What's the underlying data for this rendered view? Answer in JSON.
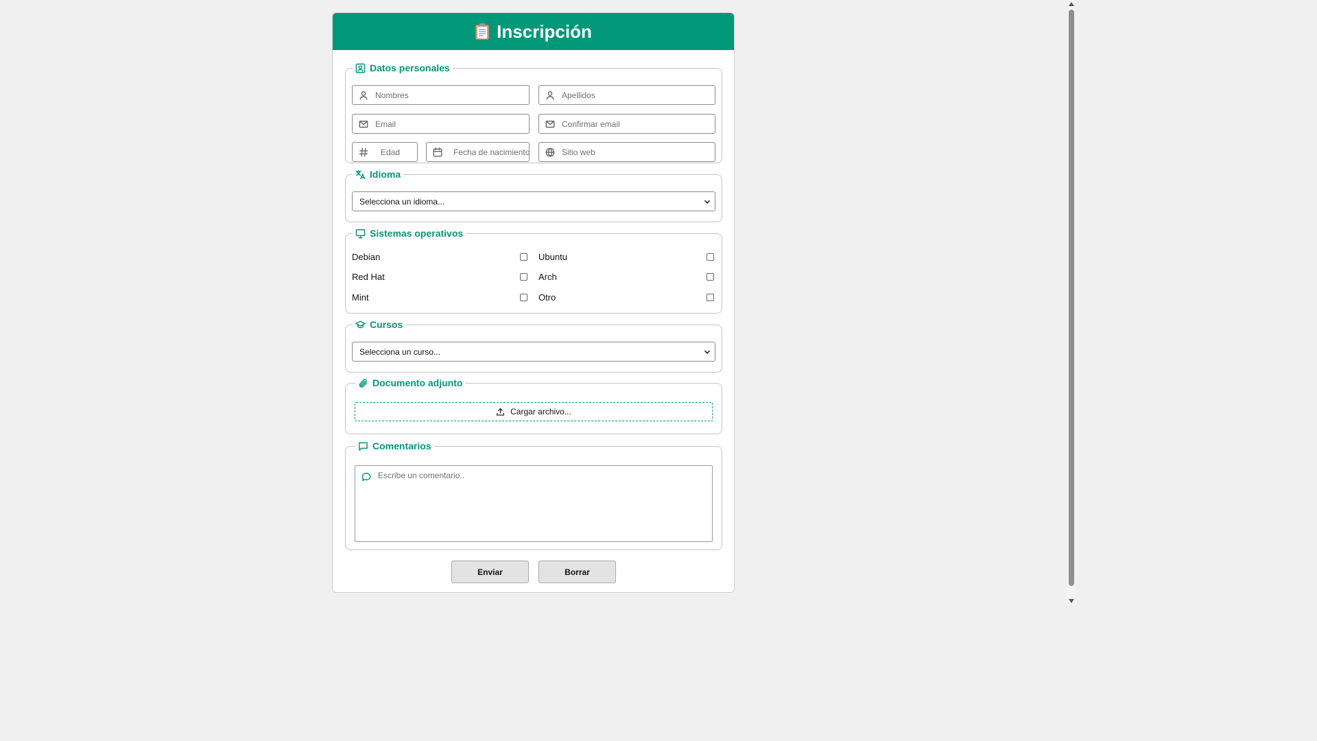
{
  "header": {
    "title": "Inscripción",
    "icon": "clipboard-icon"
  },
  "personal": {
    "legend": "Datos personales",
    "nombres_placeholder": "Nombres",
    "apellidos_placeholder": "Apellidos",
    "email_placeholder": "Email",
    "confirm_email_placeholder": "Confirmar email",
    "edad_placeholder": "Edad",
    "fecha_placeholder": "Fecha de nacimiento",
    "sitio_placeholder": "Sitio web"
  },
  "idioma": {
    "legend": "Idioma",
    "selected": "Selecciona un idioma..."
  },
  "sistemas": {
    "legend": "Sistemas operativos",
    "options": [
      "Debian",
      "Ubuntu",
      "Red Hat",
      "Arch",
      "Mint",
      "Otro"
    ]
  },
  "cursos": {
    "legend": "Cursos",
    "selected": "Selecciona un curso..."
  },
  "documento": {
    "legend": "Documento adjunto",
    "upload_label": "Cargar archivo..."
  },
  "comentarios": {
    "legend": "Comentarios",
    "placeholder": "Escribe un comentario.."
  },
  "buttons": {
    "submit": "Enviar",
    "reset": "Borrar"
  },
  "colors": {
    "accent": "#009879",
    "page_bg": "#f0f0f0",
    "button_bg": "#e3e3e3"
  }
}
